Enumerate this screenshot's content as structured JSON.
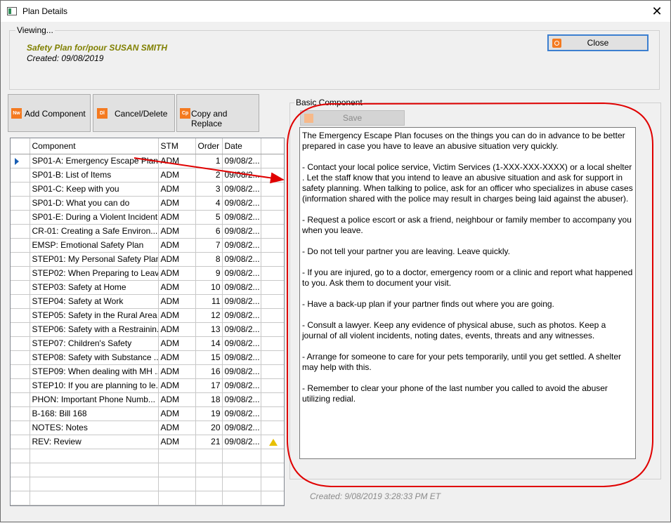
{
  "window": {
    "title": "Plan Details"
  },
  "header": {
    "viewing_label": "Viewing...",
    "plan_title": "Safety Plan for/pour SUSAN SMITH",
    "created": "Created: 09/08/2019",
    "close_label": "Close"
  },
  "toolbar": {
    "add": {
      "icon_text": "Nw",
      "label": "Add Component"
    },
    "cancel": {
      "icon_text": "Dl",
      "label": "Cancel/Delete"
    },
    "copy": {
      "icon_text": "Cp",
      "label": "Copy and Replace"
    }
  },
  "grid": {
    "columns": [
      "Component",
      "STM",
      "Order",
      "Date"
    ],
    "rows": [
      {
        "component": "SP01-A: Emergency Escape Plan",
        "stm": "ADM",
        "order": "1",
        "date": "09/08/2..."
      },
      {
        "component": "SP01-B: List of Items",
        "stm": "ADM",
        "order": "2",
        "date": "09/08/2..."
      },
      {
        "component": "SP01-C: Keep with you",
        "stm": "ADM",
        "order": "3",
        "date": "09/08/2..."
      },
      {
        "component": "SP01-D: What you can do",
        "stm": "ADM",
        "order": "4",
        "date": "09/08/2..."
      },
      {
        "component": "SP01-E: During a Violent Incident",
        "stm": "ADM",
        "order": "5",
        "date": "09/08/2..."
      },
      {
        "component": "CR-01: Creating a Safe Environ...",
        "stm": "ADM",
        "order": "6",
        "date": "09/08/2..."
      },
      {
        "component": "EMSP: Emotional Safety Plan",
        "stm": "ADM",
        "order": "7",
        "date": "09/08/2..."
      },
      {
        "component": "STEP01: My Personal Safety Plan",
        "stm": "ADM",
        "order": "8",
        "date": "09/08/2..."
      },
      {
        "component": "STEP02: When Preparing to Leave",
        "stm": "ADM",
        "order": "9",
        "date": "09/08/2..."
      },
      {
        "component": "STEP03: Safety at Home",
        "stm": "ADM",
        "order": "10",
        "date": "09/08/2..."
      },
      {
        "component": "STEP04: Safety at Work",
        "stm": "ADM",
        "order": "11",
        "date": "09/08/2..."
      },
      {
        "component": "STEP05: Safety in the Rural Area",
        "stm": "ADM",
        "order": "12",
        "date": "09/08/2..."
      },
      {
        "component": "STEP06: Safety with a Restrainin...",
        "stm": "ADM",
        "order": "13",
        "date": "09/08/2..."
      },
      {
        "component": "STEP07: Children's Safety",
        "stm": "ADM",
        "order": "14",
        "date": "09/08/2..."
      },
      {
        "component": "STEP08: Safety with Substance ...",
        "stm": "ADM",
        "order": "15",
        "date": "09/08/2..."
      },
      {
        "component": "STEP09: When dealing with MH ...",
        "stm": "ADM",
        "order": "16",
        "date": "09/08/2..."
      },
      {
        "component": "STEP10: If you are planning to le...",
        "stm": "ADM",
        "order": "17",
        "date": "09/08/2..."
      },
      {
        "component": "PHON: Important Phone Numb...",
        "stm": "ADM",
        "order": "18",
        "date": "09/08/2..."
      },
      {
        "component": "B-168: Bill 168",
        "stm": "ADM",
        "order": "19",
        "date": "09/08/2..."
      },
      {
        "component": "NOTES: Notes",
        "stm": "ADM",
        "order": "20",
        "date": "09/08/2..."
      },
      {
        "component": "REV: Review",
        "stm": "ADM",
        "order": "21",
        "date": "09/08/2...",
        "warning": true
      }
    ]
  },
  "basic": {
    "label": "Basic Component",
    "save_label": "Save",
    "text": "The Emergency Escape Plan focuses on the things you can do in advance to be better prepared in case you have to leave an abusive situation very quickly.\n\n- Contact your local police service, Victim Services (1-XXX-XXX-XXXX) or a local shelter . Let the staff know that you intend to leave an abusive situation and ask for support in safety planning. When talking to police, ask for an officer who specializes in abuse cases (information shared with the police may result in charges being laid against the abuser).\n\n- Request a police escort or ask a friend, neighbour or family member to accompany you when you leave.\n\n- Do not tell your partner you are leaving. Leave quickly.\n\n- If you are injured, go to a doctor, emergency room or a clinic and report what happened to you. Ask them to document your visit.\n\n- Have a back-up plan if your partner finds out where you are going.\n\n- Consult a lawyer. Keep any evidence of physical abuse, such as photos. Keep a journal of all violent incidents, noting dates, events, threats and any witnesses.\n\n- Arrange for someone to care for your pets temporarily, until you get settled. A shelter may help with this.\n\n- Remember to clear your phone of the last number you called to avoid the abuser utilizing redial.",
    "footer_created": "Created: 9/08/2019 3:28:33 PM ET"
  },
  "colors": {
    "plan_title": "#808000",
    "accent_icon": "#f47a20",
    "annotation": "#e00000",
    "selection_pointer": "#1a5fb4"
  }
}
